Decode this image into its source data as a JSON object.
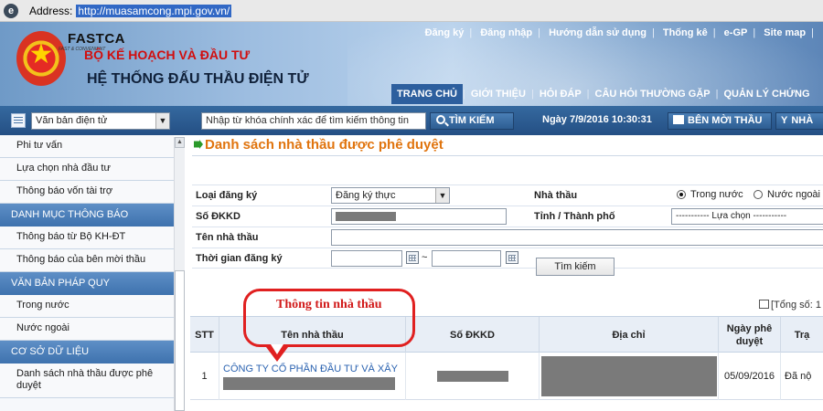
{
  "address_bar": {
    "label": "Address:",
    "url": "http://muasamcong.mpi.gov.vn/"
  },
  "header": {
    "logo_text": "FASTCA",
    "logo_tagline": "FAST & CONVENIENT",
    "ministry": "BỘ KẾ HOẠCH VÀ ĐẦU TƯ",
    "system_title": "HỆ THỐNG ĐẤU THẦU ĐIỆN TỬ",
    "top_links": [
      "Đăng ký",
      "Đăng nhập",
      "Hướng dẫn sử dụng",
      "Thống kê",
      "e-GP",
      "Site map"
    ],
    "separator": "|",
    "main_nav": [
      "TRANG CHỦ",
      "GIỚI THIỆU",
      "HỎI ĐÁP",
      "CÂU HỎI THƯỜNG GẶP",
      "QUẢN LÝ CHỨNG"
    ]
  },
  "toolbar": {
    "doc_select": "Văn bản điện tử",
    "search_value": "Nhập từ khóa chính xác để tìm kiếm thông tin",
    "search_button": "TÌM KIẾM",
    "datetime": "Ngày 7/9/2016 10:30:31",
    "bid_button": "BÊN MỜI THẦU",
    "contractor_button": "NHÀ"
  },
  "sidebar": {
    "items": [
      {
        "type": "item",
        "label": "Phi tư vấn"
      },
      {
        "type": "item",
        "label": "Lựa chọn nhà đầu tư"
      },
      {
        "type": "item",
        "label": "Thông báo vốn tài trợ"
      },
      {
        "type": "header",
        "label": "DANH MỤC THÔNG BÁO"
      },
      {
        "type": "item",
        "label": "Thông báo từ Bộ KH-ĐT"
      },
      {
        "type": "item",
        "label": "Thông báo của bên mời thầu"
      },
      {
        "type": "header",
        "label": "VĂN BẢN PHÁP QUY"
      },
      {
        "type": "item",
        "label": "Trong nước"
      },
      {
        "type": "item",
        "label": "Nước ngoài"
      },
      {
        "type": "header",
        "label": "CƠ SỞ DỮ LIỆU"
      },
      {
        "type": "item",
        "label": "Danh sách nhà thầu được phê duyệt"
      }
    ]
  },
  "page": {
    "title": "Danh sách nhà thầu được phê duyệt",
    "form": {
      "reg_type_label": "Loại đăng ký",
      "reg_type_value": "Đăng ký thực",
      "contractor_label": "Nhà thầu",
      "radio_domestic": "Trong nước",
      "radio_foreign": "Nước ngoài",
      "business_id_label": "Số ĐKKD",
      "province_label": "Tỉnh / Thành phố",
      "province_value": "----------- Lựa chọn -----------",
      "contractor_name_label": "Tên nhà thầu",
      "reg_time_label": "Thời gian đăng ký",
      "range_separator": "~",
      "search_button": "Tìm kiếm"
    },
    "info_title": "Thông tin nhà thầu",
    "total_label": "[Tổng số: 1"
  },
  "table": {
    "columns": [
      "STT",
      "Tên nhà thầu",
      "Số ĐKKD",
      "Địa chỉ",
      "Ngày phê duyệt",
      "Trạ"
    ],
    "rows": [
      {
        "stt": "1",
        "name": "CÔNG TY CỔ PHẦN ĐẦU TƯ VÀ XÂY",
        "date": "05/09/2016",
        "status": "Đã nộ"
      }
    ]
  },
  "colors": {
    "accent_orange": "#e0740e",
    "callout_red": "#e02020",
    "link_blue": "#2a62b0",
    "nav_blue": "#2d5f9e"
  }
}
